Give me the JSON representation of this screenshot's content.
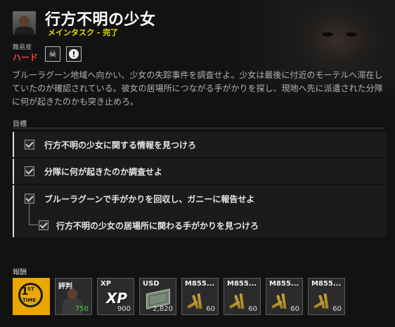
{
  "header": {
    "title": "行方不明の少女",
    "subtitle_type": "メインタスク",
    "subtitle_sep": " - ",
    "subtitle_status": "完了"
  },
  "difficulty": {
    "label": "難易度",
    "value": "ハード",
    "icons": [
      "skull-icon",
      "alert-icon"
    ]
  },
  "description": "ブルーラグーン地域へ向かい、少女の失踪事件を調査せよ。少女は最後に付近のモーテルへ滞在していたのが確認されている。彼女の居場所につながる手がかりを探し、現地へ先に派遣された分隊に何が起きたのかも突き止めろ。",
  "objectives": {
    "label": "目標",
    "items": [
      {
        "text": "行方不明の少女に関する情報を見つけろ",
        "done": true
      },
      {
        "text": "分隊に何が起きたのか調査せよ",
        "done": true
      },
      {
        "text": "ブルーラグーンで手がかりを回収し、ガニーに報告せよ",
        "done": true,
        "sub": {
          "text": "行方不明の少女の居場所に関わる手がかりを見つけろ",
          "done": true
        }
      }
    ]
  },
  "rewards": {
    "label": "報酬",
    "items": [
      {
        "kind": "first-time",
        "label": "",
        "qty": "",
        "glyph_1": "1",
        "glyph_st": "ST",
        "glyph_time": "TIME"
      },
      {
        "kind": "reputation",
        "label": "評判",
        "qty": "750"
      },
      {
        "kind": "xp",
        "label": "XP",
        "qty": "900",
        "glyph": "XP"
      },
      {
        "kind": "usd",
        "label": "USD",
        "qty": "2,820"
      },
      {
        "kind": "ammo",
        "label": "M855...",
        "qty": "60"
      },
      {
        "kind": "ammo",
        "label": "M855...",
        "qty": "60"
      },
      {
        "kind": "ammo",
        "label": "M855...",
        "qty": "60"
      },
      {
        "kind": "ammo",
        "label": "M855...",
        "qty": "60"
      }
    ]
  },
  "colors": {
    "title": "#ffffff",
    "subtitle": "#e8e000",
    "difficulty": "#ff4545",
    "first_time_bg": "#e8a800",
    "reputation_qty": "#3fd43f"
  }
}
